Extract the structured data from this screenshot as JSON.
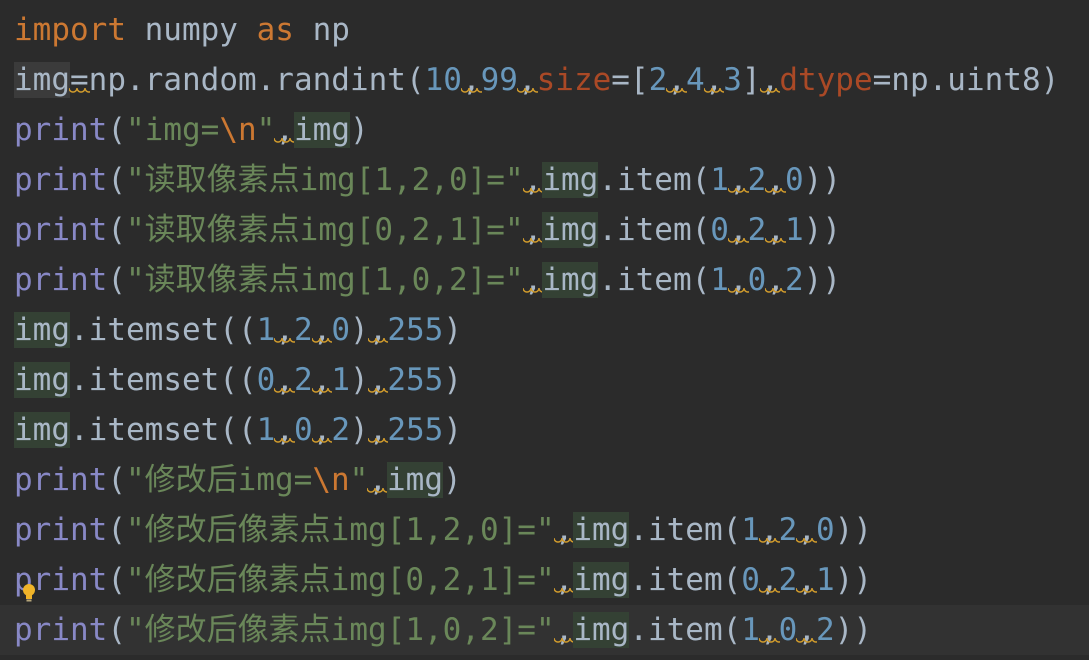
{
  "editor": {
    "language": "Python",
    "theme": "dark",
    "current_line": 13,
    "intention_icon": "lightbulb-icon",
    "colors": {
      "background": "#2b2b2b",
      "keyword": "#cc7832",
      "builtin": "#8888c6",
      "identifier": "#a9b7c6",
      "number": "#6897bb",
      "string": "#6a8759",
      "named_param": "#aa4926",
      "highlight": "#344134",
      "warning": "#d09b2c"
    },
    "lines": [
      [
        [
          "kw",
          "import"
        ],
        [
          "id",
          " numpy "
        ],
        [
          "kw",
          "as"
        ],
        [
          "id",
          " np"
        ]
      ],
      [
        [
          "id",
          "img",
          "hl-soft"
        ],
        [
          "pun",
          "=",
          "warn"
        ],
        [
          "id",
          "np.random.randint("
        ],
        [
          "num",
          "10"
        ],
        [
          "pun",
          ",",
          "warn"
        ],
        [
          "num",
          "99"
        ],
        [
          "pun",
          ",",
          "warn"
        ],
        [
          "param",
          "size"
        ],
        [
          "pun",
          "=["
        ],
        [
          "num",
          "2"
        ],
        [
          "pun",
          ",",
          "warn"
        ],
        [
          "num",
          "4"
        ],
        [
          "pun",
          ",",
          "warn"
        ],
        [
          "num",
          "3"
        ],
        [
          "pun",
          "]"
        ],
        [
          "pun",
          ",",
          "warn"
        ],
        [
          "param",
          "dtype"
        ],
        [
          "pun",
          "=np.uint8)"
        ]
      ],
      [
        [
          "fn",
          "print"
        ],
        [
          "pun",
          "("
        ],
        [
          "str",
          "\"img="
        ],
        [
          "esc",
          "\\n"
        ],
        [
          "str",
          "\""
        ],
        [
          "pun",
          ",",
          "warn"
        ],
        [
          "id",
          "img",
          "hl"
        ],
        [
          "pun",
          ")"
        ]
      ],
      [
        [
          "fn",
          "print"
        ],
        [
          "pun",
          "("
        ],
        [
          "str",
          "\"读取像素点img[1,2,0]=\""
        ],
        [
          "pun",
          ",",
          "warn"
        ],
        [
          "id",
          "img",
          "hl"
        ],
        [
          "pun",
          ".item("
        ],
        [
          "num",
          "1"
        ],
        [
          "pun",
          ",",
          "warn"
        ],
        [
          "num",
          "2"
        ],
        [
          "pun",
          ",",
          "warn"
        ],
        [
          "num",
          "0"
        ],
        [
          "pun",
          "))"
        ]
      ],
      [
        [
          "fn",
          "print"
        ],
        [
          "pun",
          "("
        ],
        [
          "str",
          "\"读取像素点img[0,2,1]=\""
        ],
        [
          "pun",
          ",",
          "warn"
        ],
        [
          "id",
          "img",
          "hl"
        ],
        [
          "pun",
          ".item("
        ],
        [
          "num",
          "0"
        ],
        [
          "pun",
          ",",
          "warn"
        ],
        [
          "num",
          "2"
        ],
        [
          "pun",
          ",",
          "warn"
        ],
        [
          "num",
          "1"
        ],
        [
          "pun",
          "))"
        ]
      ],
      [
        [
          "fn",
          "print"
        ],
        [
          "pun",
          "("
        ],
        [
          "str",
          "\"读取像素点img[1,0,2]=\""
        ],
        [
          "pun",
          ",",
          "warn"
        ],
        [
          "id",
          "img",
          "hl"
        ],
        [
          "pun",
          ".item("
        ],
        [
          "num",
          "1"
        ],
        [
          "pun",
          ",",
          "warn"
        ],
        [
          "num",
          "0"
        ],
        [
          "pun",
          ",",
          "warn"
        ],
        [
          "num",
          "2"
        ],
        [
          "pun",
          "))"
        ]
      ],
      [
        [
          "id",
          "img",
          "hl"
        ],
        [
          "pun",
          ".itemset(("
        ],
        [
          "num",
          "1"
        ],
        [
          "pun",
          ",",
          "warn"
        ],
        [
          "num",
          "2"
        ],
        [
          "pun",
          ",",
          "warn"
        ],
        [
          "num",
          "0"
        ],
        [
          "pun",
          ")"
        ],
        [
          "pun",
          ",",
          "warn"
        ],
        [
          "num",
          "255"
        ],
        [
          "pun",
          ")"
        ]
      ],
      [
        [
          "id",
          "img",
          "hl"
        ],
        [
          "pun",
          ".itemset(("
        ],
        [
          "num",
          "0"
        ],
        [
          "pun",
          ",",
          "warn"
        ],
        [
          "num",
          "2"
        ],
        [
          "pun",
          ",",
          "warn"
        ],
        [
          "num",
          "1"
        ],
        [
          "pun",
          ")"
        ],
        [
          "pun",
          ",",
          "warn"
        ],
        [
          "num",
          "255"
        ],
        [
          "pun",
          ")"
        ]
      ],
      [
        [
          "id",
          "img",
          "hl"
        ],
        [
          "pun",
          ".itemset(("
        ],
        [
          "num",
          "1"
        ],
        [
          "pun",
          ",",
          "warn"
        ],
        [
          "num",
          "0"
        ],
        [
          "pun",
          ",",
          "warn"
        ],
        [
          "num",
          "2"
        ],
        [
          "pun",
          ")"
        ],
        [
          "pun",
          ",",
          "warn"
        ],
        [
          "num",
          "255"
        ],
        [
          "pun",
          ")"
        ]
      ],
      [
        [
          "fn",
          "print"
        ],
        [
          "pun",
          "("
        ],
        [
          "str",
          "\"修改后img="
        ],
        [
          "esc",
          "\\n"
        ],
        [
          "str",
          "\""
        ],
        [
          "pun",
          ",",
          "warn"
        ],
        [
          "id",
          "img",
          "hl"
        ],
        [
          "pun",
          ")"
        ]
      ],
      [
        [
          "fn",
          "print"
        ],
        [
          "pun",
          "("
        ],
        [
          "str",
          "\"修改后像素点img[1,2,0]=\""
        ],
        [
          "pun",
          ",",
          "warn"
        ],
        [
          "id",
          "img",
          "hl"
        ],
        [
          "pun",
          ".item("
        ],
        [
          "num",
          "1"
        ],
        [
          "pun",
          ",",
          "warn"
        ],
        [
          "num",
          "2"
        ],
        [
          "pun",
          ",",
          "warn"
        ],
        [
          "num",
          "0"
        ],
        [
          "pun",
          "))"
        ]
      ],
      [
        [
          "fn",
          "print"
        ],
        [
          "pun",
          "("
        ],
        [
          "str",
          "\"修改后像素点img[0,2,1]=\""
        ],
        [
          "pun",
          ",",
          "warn"
        ],
        [
          "id",
          "img",
          "hl"
        ],
        [
          "pun",
          ".item("
        ],
        [
          "num",
          "0"
        ],
        [
          "pun",
          ",",
          "warn"
        ],
        [
          "num",
          "2"
        ],
        [
          "pun",
          ",",
          "warn"
        ],
        [
          "num",
          "1"
        ],
        [
          "pun",
          "))"
        ]
      ],
      [
        [
          "fn",
          "print"
        ],
        [
          "pun",
          "("
        ],
        [
          "str",
          "\"修改后像素点img[1,0,2]=\""
        ],
        [
          "pun",
          ",",
          "warn"
        ],
        [
          "id",
          "img",
          "hl"
        ],
        [
          "pun",
          ".item("
        ],
        [
          "num",
          "1"
        ],
        [
          "pun",
          ",",
          "warn"
        ],
        [
          "num",
          "0"
        ],
        [
          "pun",
          ",",
          "warn"
        ],
        [
          "num",
          "2"
        ],
        [
          "pun",
          "))"
        ]
      ]
    ]
  }
}
